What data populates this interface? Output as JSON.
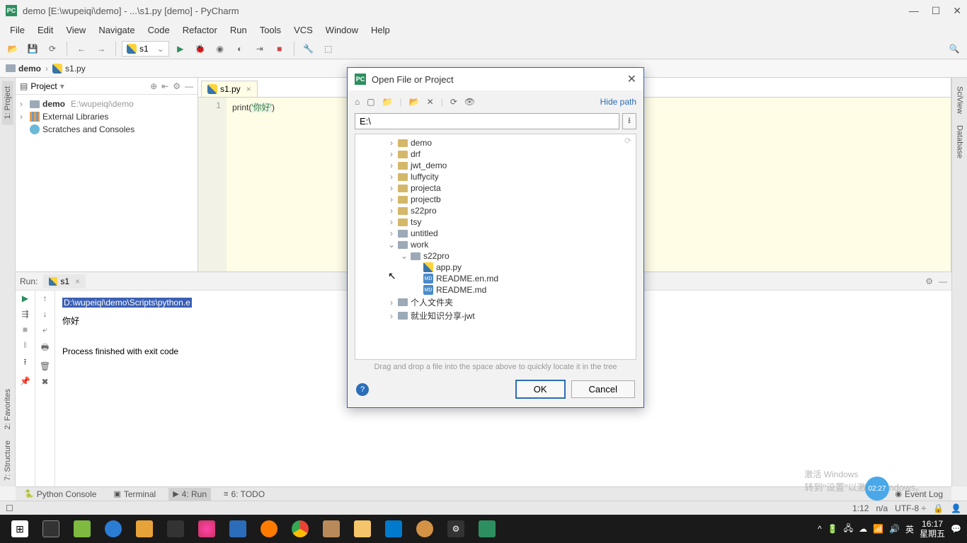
{
  "window": {
    "title": "demo [E:\\wupeiqi\\demo] - ...\\s1.py [demo] - PyCharm"
  },
  "menu": [
    "File",
    "Edit",
    "View",
    "Navigate",
    "Code",
    "Refactor",
    "Run",
    "Tools",
    "VCS",
    "Window",
    "Help"
  ],
  "run_config": "s1",
  "breadcrumb": {
    "folder": "demo",
    "file": "s1.py"
  },
  "project": {
    "title": "Project",
    "items": [
      {
        "name": "demo",
        "path": "E:\\wupeiqi\\demo",
        "type": "folder"
      },
      {
        "name": "External Libraries",
        "type": "lib"
      },
      {
        "name": "Scratches and Consoles",
        "type": "scratch"
      }
    ]
  },
  "editor": {
    "tab": "s1.py",
    "line_no": "1",
    "code_kw": "print",
    "code_str": "'你好'"
  },
  "run_panel": {
    "label": "Run:",
    "tab": "s1",
    "cmd": "D:\\wupeiqi\\demo\\Scripts\\python.e",
    "output": "你好",
    "exit": "Process finished with exit code "
  },
  "left_tabs": [
    "1: Project",
    "2: Favorites",
    "7: Structure"
  ],
  "right_tabs": [
    "SciView",
    "Database"
  ],
  "bottom_tabs": {
    "python_console": "Python Console",
    "terminal": "Terminal",
    "run": "4: Run",
    "todo": "6: TODO",
    "event_log": "Event Log"
  },
  "status": {
    "pos": "1:12",
    "na": "n/a",
    "encoding": "UTF-8"
  },
  "dialog": {
    "title": "Open File or Project",
    "hide_path": "Hide path",
    "path": "E:\\",
    "hint": "Drag and drop a file into the space above to quickly locate it in the tree",
    "ok": "OK",
    "cancel": "Cancel",
    "tree": [
      {
        "indent": 2,
        "exp": ">",
        "type": "folder",
        "name": "demo"
      },
      {
        "indent": 2,
        "exp": ">",
        "type": "folder",
        "name": "drf"
      },
      {
        "indent": 2,
        "exp": ">",
        "type": "folder",
        "name": "jwt_demo"
      },
      {
        "indent": 2,
        "exp": ">",
        "type": "folder",
        "name": "luffycity"
      },
      {
        "indent": 2,
        "exp": ">",
        "type": "folder",
        "name": "projecta"
      },
      {
        "indent": 2,
        "exp": ">",
        "type": "folder",
        "name": "projectb"
      },
      {
        "indent": 2,
        "exp": ">",
        "type": "folder",
        "name": "s22pro"
      },
      {
        "indent": 2,
        "exp": ">",
        "type": "folder",
        "name": "tsy"
      },
      {
        "indent": 2,
        "exp": ">",
        "type": "folder-gray",
        "name": "untitled"
      },
      {
        "indent": 2,
        "exp": "v",
        "type": "folder-gray",
        "name": "work"
      },
      {
        "indent": 3,
        "exp": "v",
        "type": "folder-gray",
        "name": "s22pro"
      },
      {
        "indent": 4,
        "exp": "",
        "type": "py",
        "name": "app.py"
      },
      {
        "indent": 4,
        "exp": "",
        "type": "md",
        "name": "README.en.md"
      },
      {
        "indent": 4,
        "exp": "",
        "type": "md",
        "name": "README.md"
      },
      {
        "indent": 2,
        "exp": ">",
        "type": "folder-gray",
        "name": "个人文件夹"
      },
      {
        "indent": 2,
        "exp": ">",
        "type": "folder-gray",
        "name": "就业知识分享-jwt"
      }
    ]
  },
  "activate": {
    "title": "激活 Windows",
    "sub": "转到\"设置\"以激活 Windows。"
  },
  "badge_time": "02:27",
  "taskbar_clock": {
    "time": "16:17",
    "date": "星期五"
  },
  "ime": "英"
}
